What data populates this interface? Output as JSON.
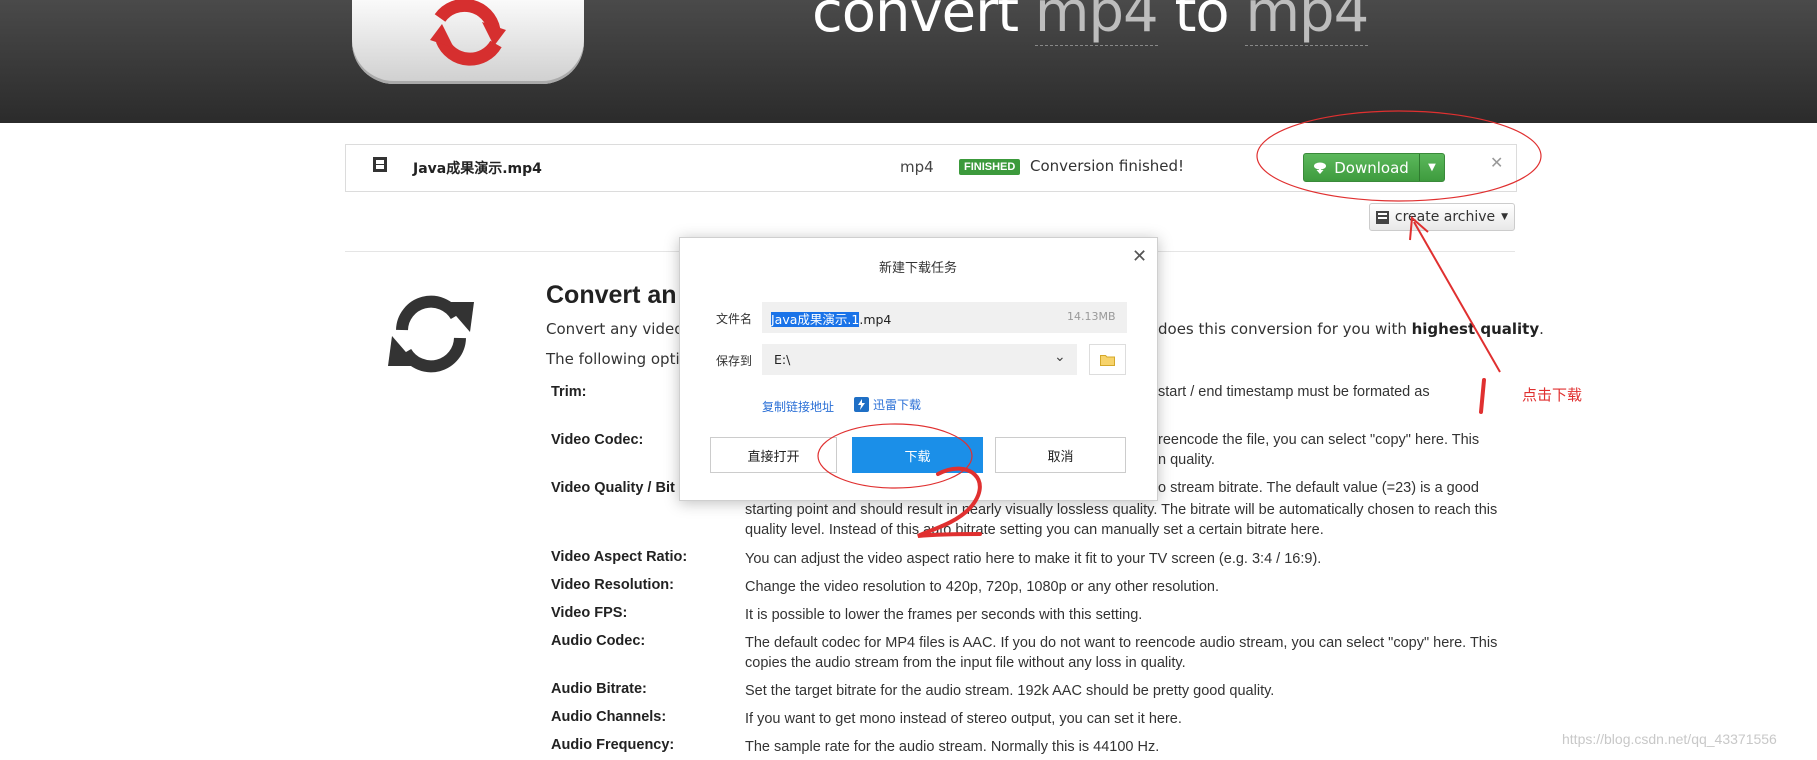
{
  "hero": {
    "prefix": "convert ",
    "from": "mp4",
    "middle": " to ",
    "to": "mp4"
  },
  "file_row": {
    "name": "Java成果演示.mp4",
    "format": "mp4",
    "badge": "FINISHED",
    "status": "Conversion finished!",
    "download_label": "Download",
    "archive_label": "create archive"
  },
  "content": {
    "title": "Convert an",
    "intro_left": "Convert any  video (",
    "intro_right_a": "does this conversion for you with ",
    "intro_right_b": "highest quality",
    "intro_right_c": ".",
    "intro_options": "The following optio",
    "options": [
      {
        "label": "Trim:",
        "desc": "start / end timestamp must be formated as"
      },
      {
        "label": "Video Codec:",
        "desc_a": "reencode the file, you can select \"copy\" here. This",
        "desc_b": "n quality."
      },
      {
        "label": "Video Quality / Bit",
        "desc_a": "o stream bitrate. The default value (=23) is a good",
        "desc_b": "starting point and should result in nearly visually lossless quality. The bitrate will be automatically chosen to reach this quality level. Instead of this auto bitrate setting you can manually set a certain bitrate here."
      },
      {
        "label": "Video Aspect Ratio:",
        "desc": "You can adjust the video aspect ratio here to make it fit to your TV screen (e.g. 3:4 / 16:9)."
      },
      {
        "label": "Video Resolution:",
        "desc": "Change the video resolution to 420p, 720p, 1080p or any other resolution."
      },
      {
        "label": "Video FPS:",
        "desc": "It is possible to lower the frames per seconds with this setting."
      },
      {
        "label": "Audio Codec:",
        "desc": "The default codec for MP4 files is AAC. If you do not want to reencode audio stream, you can select \"copy\" here. This copies the audio stream from the input file without any loss in quality."
      },
      {
        "label": "Audio Bitrate:",
        "desc": "Set the target bitrate for the audio stream. 192k AAC should be pretty good quality."
      },
      {
        "label": "Audio Channels:",
        "desc": "If you want to get mono instead of stereo output, you can set it here."
      },
      {
        "label": "Audio Frequency:",
        "desc": "The sample rate for the audio stream. Normally this is 44100 Hz."
      }
    ]
  },
  "dialog": {
    "title": "新建下载任务",
    "file_label": "文件名",
    "file_name_selected": "Java成果演示.1",
    "file_name_rest": ".mp4",
    "file_size": "14.13MB",
    "save_label": "保存到",
    "save_path": "E:\\",
    "copy_link": "复制链接地址",
    "thunder": "迅雷下载",
    "btn_open": "直接打开",
    "btn_download": "下载",
    "btn_cancel": "取消"
  },
  "annotation": {
    "text": "点击下载"
  },
  "watermark": "https://blog.csdn.net/qq_43371556",
  "colors": {
    "annotation": "#e03030",
    "download_green": "#5cb85c",
    "dialog_blue": "#1b8fe8"
  }
}
